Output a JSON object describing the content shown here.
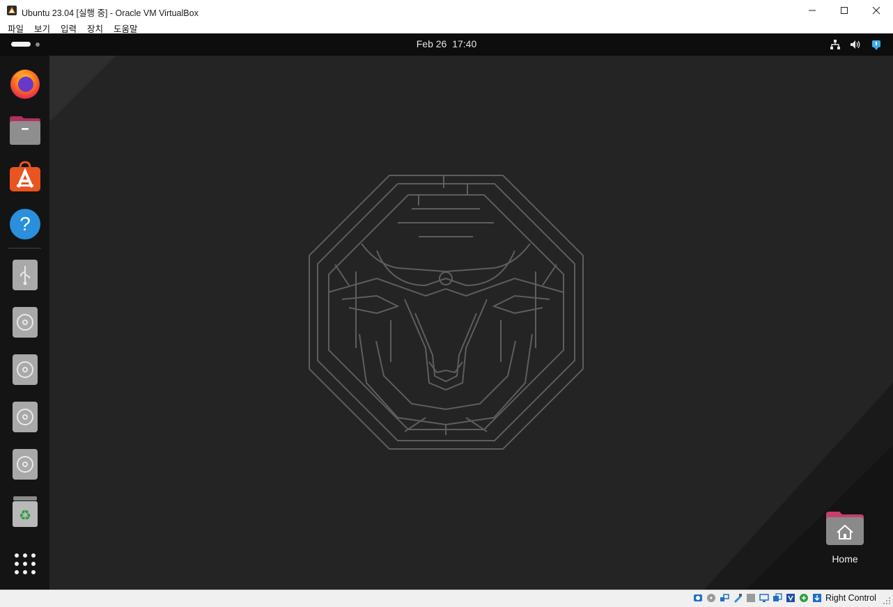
{
  "window": {
    "title": "Ubuntu 23.04 [실행 중] - Oracle VM VirtualBox",
    "controls": [
      "minimize",
      "maximize",
      "close"
    ]
  },
  "menubar": {
    "items": [
      "파일",
      "보기",
      "입력",
      "장치",
      "도움말"
    ]
  },
  "guest": {
    "topbar": {
      "date": "Feb 26",
      "time": "17:40",
      "tray_icons": [
        "network-icon",
        "volume-icon",
        "power-icon"
      ]
    },
    "dock": {
      "apps": [
        {
          "name": "firefox",
          "icon": "firefox-icon"
        },
        {
          "name": "files",
          "icon": "files-icon"
        },
        {
          "name": "app-center",
          "icon": "app-center-icon"
        },
        {
          "name": "help",
          "icon": "help-icon"
        }
      ],
      "devices": [
        {
          "name": "usb",
          "icon": "usb-drive-icon"
        },
        {
          "name": "disc-1",
          "icon": "optical-disc-icon"
        },
        {
          "name": "disc-2",
          "icon": "optical-disc-icon"
        },
        {
          "name": "disc-3",
          "icon": "optical-disc-icon"
        },
        {
          "name": "disc-4",
          "icon": "optical-disc-icon"
        }
      ],
      "trash": {
        "icon": "trash-icon"
      },
      "show_apps": {
        "icon": "app-grid-icon"
      }
    },
    "desktop": {
      "home_label": "Home"
    },
    "colors": {
      "topbar": "#0d0d0d",
      "dock": "#141414",
      "desktop": "#242424",
      "accent": "#e95420"
    }
  },
  "statusbar": {
    "host_key": "Right Control",
    "icons": [
      "hard-disk-icon",
      "optical-drive-icon",
      "network-adapters-icon",
      "usb-icon",
      "shared-folders-icon",
      "display-icon",
      "recording-icon",
      "virtualization-icon",
      "mouse-integration-icon",
      "keyboard-capture-icon"
    ]
  }
}
